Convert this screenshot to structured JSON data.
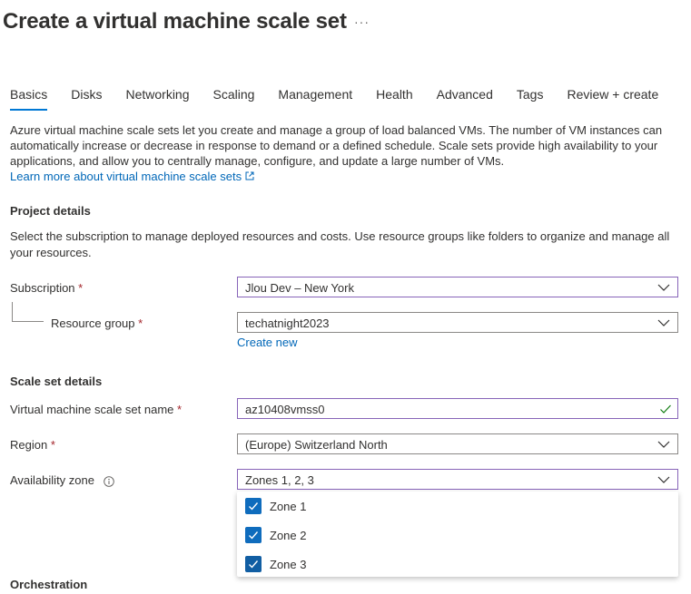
{
  "page": {
    "title": "Create a virtual machine scale set",
    "more_label": "···"
  },
  "tabs": [
    {
      "label": "Basics",
      "active": true
    },
    {
      "label": "Disks"
    },
    {
      "label": "Networking"
    },
    {
      "label": "Scaling"
    },
    {
      "label": "Management"
    },
    {
      "label": "Health"
    },
    {
      "label": "Advanced"
    },
    {
      "label": "Tags"
    },
    {
      "label": "Review + create"
    }
  ],
  "intro": {
    "text": "Azure virtual machine scale sets let you create and manage a group of load balanced VMs. The number of VM instances can automatically increase or decrease in response to demand or a defined schedule. Scale sets provide high availability to your applications, and allow you to centrally manage, configure, and update a large number of VMs.",
    "learn_more": "Learn more about virtual machine scale sets",
    "external_icon": "external-link-icon"
  },
  "project": {
    "heading": "Project details",
    "description": "Select the subscription to manage deployed resources and costs. Use resource groups like folders to organize and manage all your resources.",
    "subscription_label": "Subscription",
    "subscription_value": "Jlou Dev – New York",
    "resource_group_label": "Resource group",
    "resource_group_value": "techatnight2023",
    "create_new": "Create new"
  },
  "scaleset": {
    "heading": "Scale set details",
    "name_label": "Virtual machine scale set name",
    "name_value": "az10408vmss0",
    "region_label": "Region",
    "region_value": "(Europe) Switzerland North",
    "zone_label": "Availability zone",
    "zone_value": "Zones 1, 2, 3",
    "zone_options": [
      {
        "label": "Zone 1",
        "checked": true
      },
      {
        "label": "Zone 2",
        "checked": true
      },
      {
        "label": "Zone 3",
        "checked": true
      }
    ]
  },
  "orchestration": {
    "heading": "Orchestration"
  },
  "required_marker": "*",
  "colors": {
    "accent": "#0078d4",
    "link": "#0067b8",
    "required": "#a4262c",
    "focus_border": "#8764b8",
    "checkbox": "#0f6cbd",
    "valid_check": "#107c10"
  }
}
